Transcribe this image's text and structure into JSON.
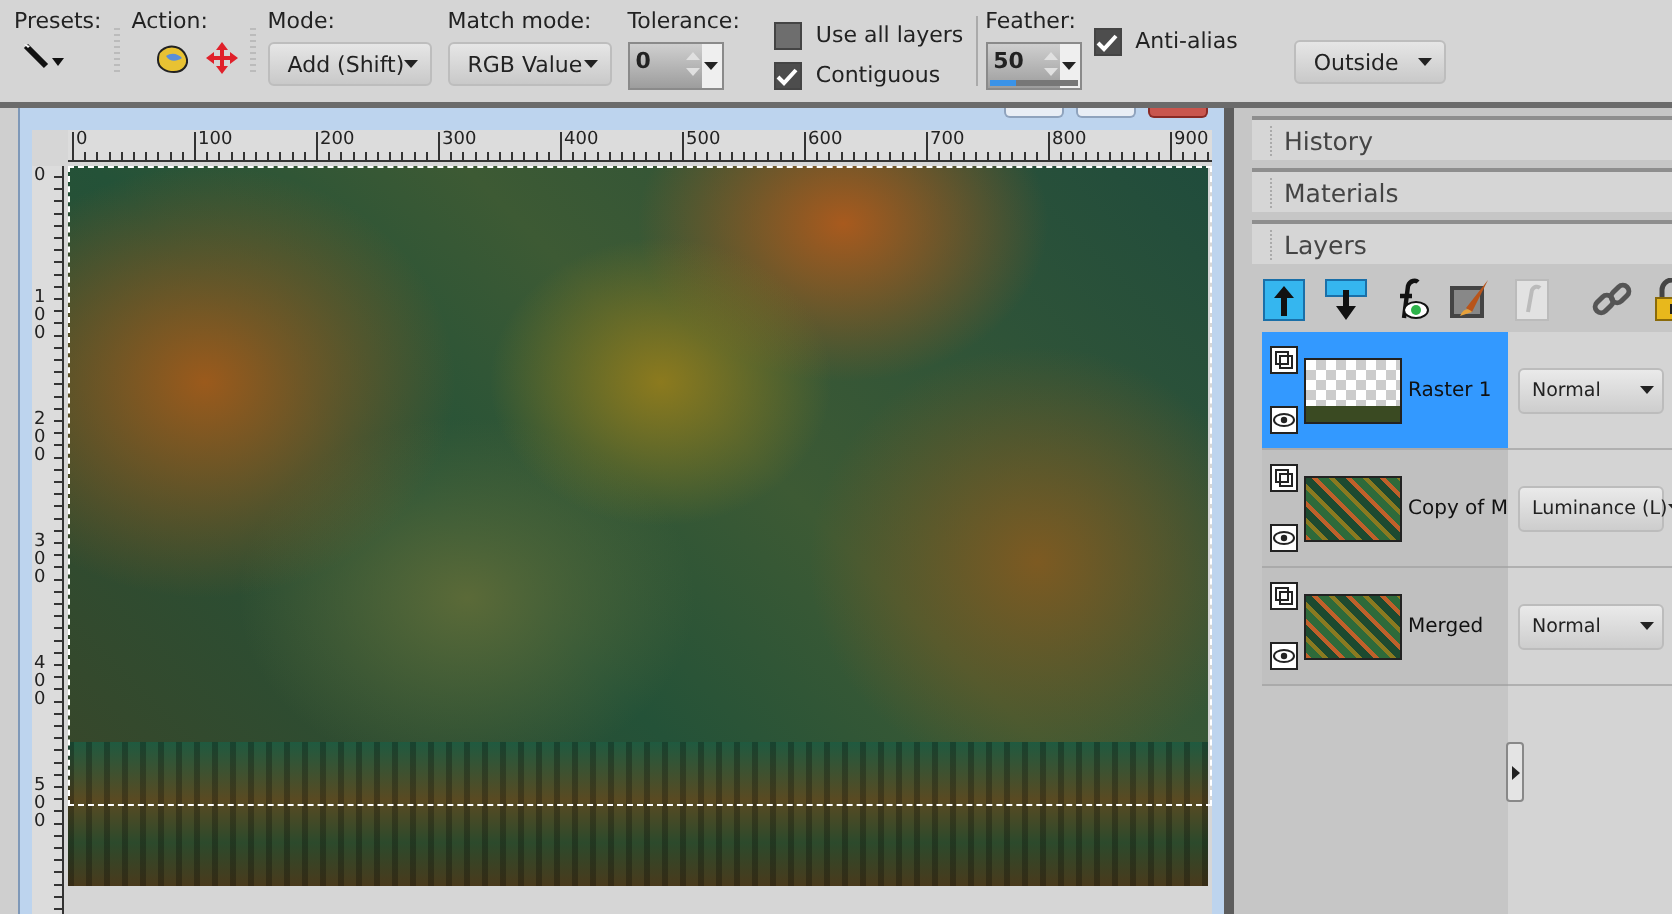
{
  "toolbar": {
    "presets": {
      "label": "Presets:"
    },
    "action": {
      "label": "Action:"
    },
    "mode": {
      "label": "Mode:",
      "value": "Add (Shift)"
    },
    "match_mode": {
      "label": "Match mode:",
      "value": "RGB Value"
    },
    "tolerance": {
      "label": "Tolerance:",
      "value": "0"
    },
    "checkboxes": [
      {
        "label": "Use all layers",
        "checked": false
      },
      {
        "label": "Contiguous",
        "checked": true
      }
    ],
    "feather": {
      "label": "Feather:",
      "value": "50",
      "level": 0.3
    },
    "anti_alias": {
      "label": "Anti-alias",
      "checked": true
    },
    "feather_side": {
      "value": "Outside"
    }
  },
  "canvas": {
    "top_ruler": [
      "0",
      "100",
      "200",
      "300",
      "400",
      "500",
      "600",
      "700",
      "800",
      "900"
    ],
    "left_ruler": [
      "0",
      "100",
      "200",
      "300",
      "400",
      "500"
    ]
  },
  "palettes": [
    {
      "title": "History"
    },
    {
      "title": "Materials"
    },
    {
      "title": "Layers"
    }
  ],
  "layers": [
    {
      "name": "Raster 1",
      "blend_mode": "Normal",
      "selected": true,
      "kind": "transparent"
    },
    {
      "name": "Copy of M",
      "blend_mode": "Luminance (L)",
      "selected": false,
      "kind": "image"
    },
    {
      "name": "Merged",
      "blend_mode": "Normal",
      "selected": false,
      "kind": "image"
    }
  ]
}
